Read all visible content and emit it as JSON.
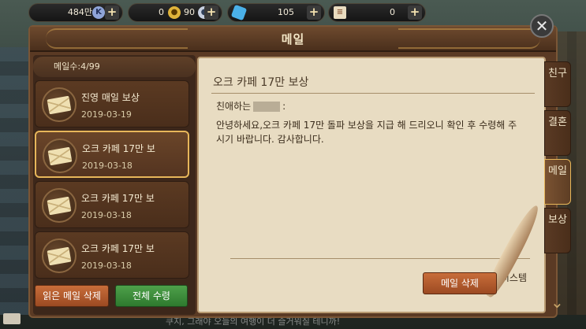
{
  "currency": {
    "gold": "484만",
    "coin_a": "0",
    "coin_b": "90",
    "gem": "105",
    "ticket": "0",
    "plus": "+"
  },
  "window": {
    "title": "메일",
    "close": "✕"
  },
  "mailbox": {
    "count_label": "메일수:4/99",
    "items": [
      {
        "title": "진영 매일 보상",
        "date": "2019-03-19"
      },
      {
        "title": "오크 카페 17만 보",
        "date": "2019-03-18"
      },
      {
        "title": "오크 카페 17만 보",
        "date": "2019-03-18"
      },
      {
        "title": "오크 카페 17만 보",
        "date": "2019-03-18"
      }
    ],
    "delete_read_label": "읽은 메일 삭제",
    "receive_all_label": "전체 수령"
  },
  "mail_view": {
    "subject": "오크 카페 17만 보상",
    "greeting_prefix": "친애하는",
    "greeting_suffix": ":",
    "body": "안녕하세요,오크 카페 17만 돌파 보상을 지급 해 드리오니 확인 후 수령해 주시기 바랍니다. 감사합니다.",
    "sender": "시스템",
    "delete_label": "메일 삭제"
  },
  "side_tabs": [
    "친구",
    "결혼",
    "메일",
    "보상"
  ],
  "side_tabs_active": "메일",
  "bottom_chat": "쿠지, 그래야 오늘의 여행이 더 즐거워질 테니까!"
}
